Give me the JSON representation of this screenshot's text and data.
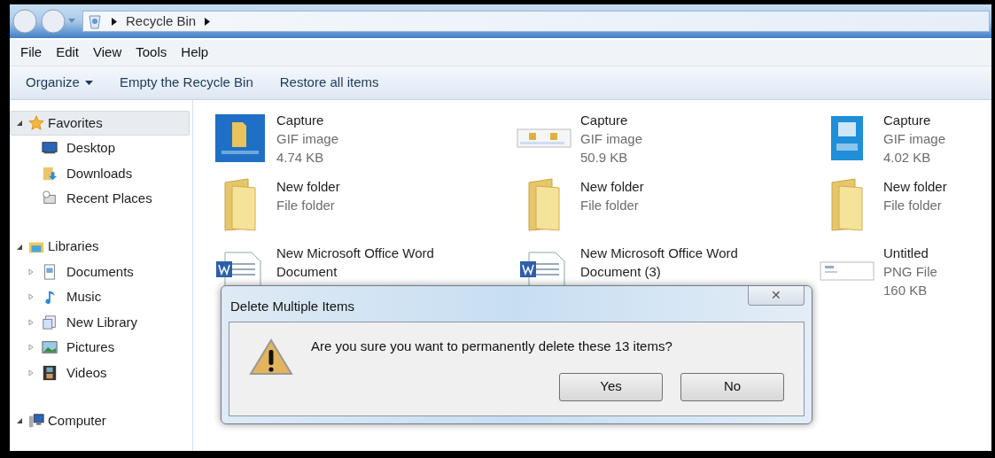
{
  "address_bar": {
    "path": [
      "Recycle Bin"
    ]
  },
  "menu_bar": [
    "File",
    "Edit",
    "View",
    "Tools",
    "Help"
  ],
  "command_bar": [
    {
      "label": "Organize",
      "kind": "dropdown"
    },
    {
      "label": "Empty the Recycle Bin",
      "kind": "button"
    },
    {
      "label": "Restore all items",
      "kind": "button"
    }
  ],
  "nav_pane": [
    {
      "label": "Favorites",
      "kind": "star",
      "expanded": true,
      "selected": true,
      "children": [
        {
          "label": "Desktop",
          "kind": "desktop",
          "selected": false
        },
        {
          "label": "Downloads",
          "kind": "downloads",
          "selected": false
        },
        {
          "label": "Recent Places",
          "kind": "recent",
          "selected": false
        }
      ]
    },
    {
      "label": "Libraries",
      "kind": "libraries",
      "expanded": true,
      "selected": false,
      "children": [
        {
          "label": "Documents",
          "kind": "documents",
          "expanded": false,
          "selected": false
        },
        {
          "label": "Music",
          "kind": "music",
          "expanded": false,
          "selected": false
        },
        {
          "label": "New Library",
          "kind": "library",
          "expanded": false,
          "selected": false
        },
        {
          "label": "Pictures",
          "kind": "pictures",
          "expanded": false,
          "selected": false
        },
        {
          "label": "Videos",
          "kind": "videos",
          "expanded": false,
          "selected": false
        }
      ]
    },
    {
      "label": "Computer",
      "kind": "computer",
      "expanded": true,
      "selected": false
    }
  ],
  "files": [
    {
      "kind": "image",
      "name": "Capture",
      "type": "GIF image",
      "size": "4.74 KB"
    },
    {
      "kind": "image",
      "name": "Capture",
      "type": "GIF image",
      "size": "50.9 KB"
    },
    {
      "kind": "image",
      "name": "Capture",
      "type": "GIF image",
      "size": "4.02 KB"
    },
    {
      "kind": "folder",
      "name": "New folder",
      "type": "File folder"
    },
    {
      "kind": "folder",
      "name": "New folder",
      "type": "File folder"
    },
    {
      "kind": "folder",
      "name": "New folder",
      "type": "File folder"
    },
    {
      "kind": "document",
      "name": "New Microsoft Office Word Document"
    },
    {
      "kind": "document",
      "name": "New Microsoft Office Word Document (3)"
    },
    {
      "kind": "image",
      "name": "Untitled",
      "type": "PNG File",
      "size": "160 KB"
    }
  ],
  "dialog": {
    "title": "Delete Multiple Items",
    "close": "✕",
    "message": "Are you sure you want to permanently delete these 13 items?",
    "buttons": [
      "Yes",
      "No"
    ]
  }
}
